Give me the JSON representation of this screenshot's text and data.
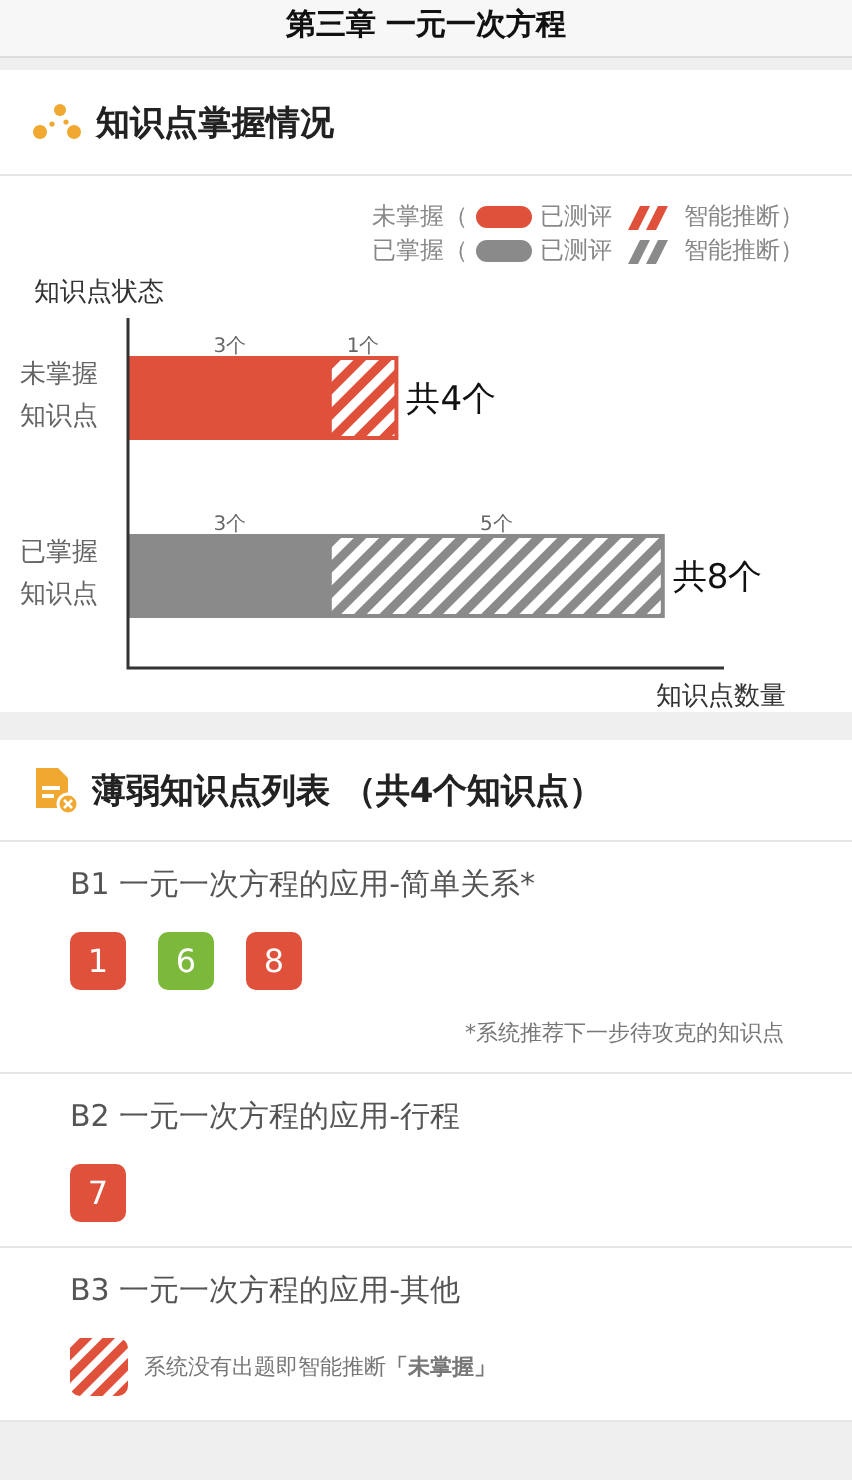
{
  "header": {
    "title": "第三章 一元一次方程"
  },
  "mastery": {
    "title": "知识点掌握情况",
    "legend": [
      {
        "label": "未掌握（",
        "tested": "已测评",
        "inferred": "智能推断）"
      },
      {
        "label": "已掌握（",
        "tested": "已测评",
        "inferred": "智能推断）"
      }
    ],
    "chart_data": {
      "type": "bar",
      "orientation": "horizontal",
      "stacked": true,
      "ylabel": "知识点状态",
      "xlabel": "知识点数量",
      "categories": [
        "未掌握知识点",
        "已掌握知识点"
      ],
      "series": [
        {
          "colors": [
            "#e0513c",
            "#8a8a8a"
          ],
          "values": [
            3,
            3
          ],
          "value_labels": [
            "3个",
            "3个"
          ]
        },
        {
          "colors": [
            "#e0513c",
            "#8a8a8a"
          ],
          "values": [
            1,
            5
          ],
          "value_labels": [
            "1个",
            "5个"
          ]
        }
      ],
      "totals": [
        "共4个",
        "共8个"
      ]
    }
  },
  "weak": {
    "title": "薄弱知识点列表 （共4个知识点）",
    "items": [
      {
        "name": "B1 一元一次方程的应用-简单关系*",
        "kind": "questions",
        "chips": [
          {
            "label": "1",
            "color": "#e0513c"
          },
          {
            "label": "6",
            "color": "#7cb93a"
          },
          {
            "label": "8",
            "color": "#e0513c"
          }
        ],
        "note": "*系统推荐下一步待攻克的知识点"
      },
      {
        "name": "B2 一元一次方程的应用-行程",
        "kind": "questions",
        "chips": [
          {
            "label": "7",
            "color": "#e0513c"
          }
        ]
      },
      {
        "name": "B3 一元一次方程的应用-其他",
        "kind": "inferred",
        "note": "系统没有出题即智能推断**「未掌握」**"
      }
    ]
  }
}
